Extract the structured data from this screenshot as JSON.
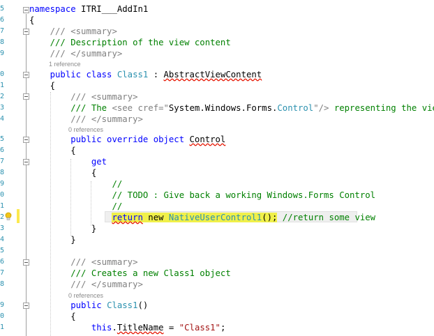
{
  "gutter": {
    "line_numbers": [
      "5",
      "6",
      "7",
      "8",
      "9",
      "0",
      "1",
      "2",
      "3",
      "4",
      "5",
      "6",
      "7",
      "8",
      "9",
      "0",
      "1",
      "2",
      "3",
      "4",
      "5",
      "6",
      "7",
      "8",
      "9",
      "0",
      "1"
    ]
  },
  "code": {
    "ns_kw": "namespace",
    "ns_name": " ITRI___AddIn1",
    "l2": "{",
    "l3": "    /// <summary>",
    "l4": "    /// Description of the view content",
    "l5": "    /// </summary>",
    "ref1": "1 reference",
    "l6_kw": "public class ",
    "l6_type": "Class1",
    "l6_sep": " : ",
    "l6_base": "AbstractViewContent",
    "l7": "    {",
    "l8": "        /// <summary>",
    "l9_a": "        /// The ",
    "l9_b": "<see cref=\"",
    "l9_c": "System.Windows.Forms.",
    "l9_d": "Control",
    "l9_e": "\"/>",
    "l9_f": " representing the view",
    "l10": "        /// </summary>",
    "ref2": "0 references",
    "l11_kw": "public override object ",
    "l11_name": "Control",
    "l12": "        {",
    "l13_kw": "get",
    "l14": "            {",
    "l15": "                //",
    "l16": "                // TODO : Give back a working Windows.Forms Control",
    "l17": "                //",
    "l18_ret": "return",
    "l18_new": " new ",
    "l18_type": "NativeUserControl1",
    "l18_end": "();",
    "l18_cm": " //return some view",
    "l19": "            }",
    "l20": "        }",
    "l22": "        /// <summary>",
    "l23": "        /// Creates a new Class1 object",
    "l24": "        /// </summary>",
    "ref3": "0 references",
    "l25_kw": "public ",
    "l25_type": "Class1",
    "l25_end": "()",
    "l26": "        {",
    "l27_kw": "this",
    "l27_a": ".",
    "l27_b": "TitleName",
    "l27_c": " = ",
    "l27_str": "\"Class1\"",
    "l27_d": ";"
  },
  "colors": {
    "keyword": "#0000ff",
    "comment": "#008000",
    "type": "#2b91af",
    "string": "#a31515",
    "highlight": "#f0f04a"
  },
  "icons": [
    "lightbulb-icon",
    "collapse-icon"
  ]
}
